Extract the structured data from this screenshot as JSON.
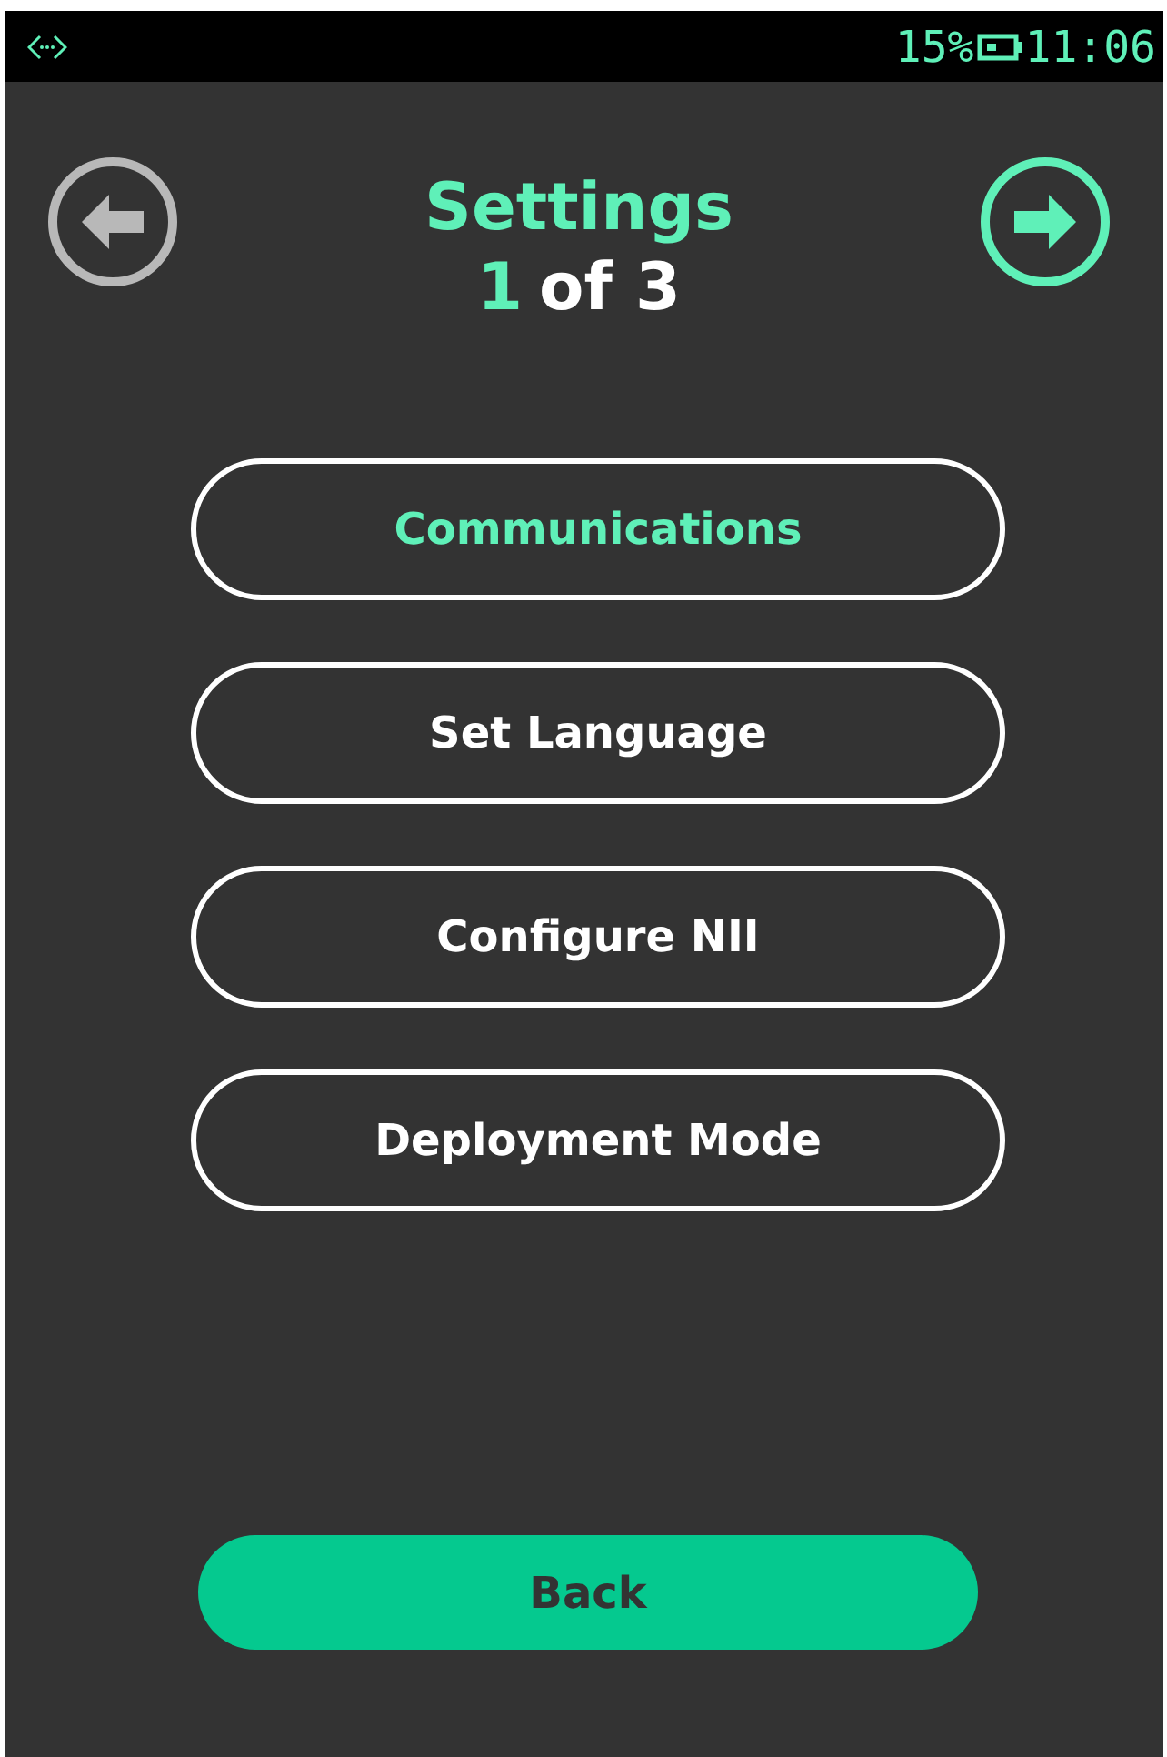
{
  "status_bar": {
    "battery": "15%",
    "time": "11:06"
  },
  "header": {
    "title": "Settings",
    "page_current": "1",
    "page_total": "of 3",
    "prev_enabled": false,
    "next_enabled": true
  },
  "menu_items": [
    {
      "label": "Communications",
      "selected": true
    },
    {
      "label": "Set Language",
      "selected": false
    },
    {
      "label": "Configure NII",
      "selected": false
    },
    {
      "label": "Deployment Mode",
      "selected": false
    }
  ],
  "back_button": {
    "label": "Back"
  }
}
